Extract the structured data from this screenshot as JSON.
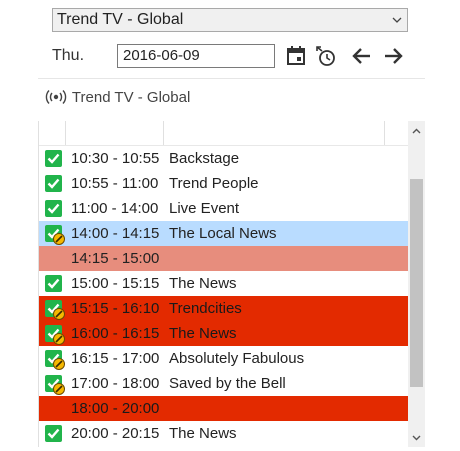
{
  "channel_select": {
    "value": "Trend TV - Global"
  },
  "date_bar": {
    "day": "Thu.",
    "date": "2016-06-09"
  },
  "channel_header": {
    "label": "Trend TV - Global"
  },
  "icons": {
    "calendar": "calendar-icon",
    "clock": "clock-icon",
    "back": "arrow-left-icon",
    "forward": "arrow-right-icon",
    "broadcast": "broadcast-icon"
  },
  "colors": {
    "check": "#21b44b",
    "warning": "#f5b800",
    "selected_row": "#b9dcff",
    "gap_row": "#e78d7d",
    "conflict_row": "#e32a00"
  },
  "schedule": [
    {
      "time": "10:30 - 10:55",
      "title": "Backstage",
      "status": "check",
      "style": "normal"
    },
    {
      "time": "10:55 - 11:00",
      "title": "Trend People",
      "status": "check",
      "style": "normal"
    },
    {
      "time": "11:00 - 14:00",
      "title": "Live Event",
      "status": "check",
      "style": "normal"
    },
    {
      "time": "14:00 - 14:15",
      "title": "The Local News",
      "status": "check-warning",
      "style": "blue"
    },
    {
      "time": "14:15 - 15:00",
      "title": "",
      "status": "none",
      "style": "salmon"
    },
    {
      "time": "15:00 - 15:15",
      "title": "The News",
      "status": "check",
      "style": "normal"
    },
    {
      "time": "15:15 - 16:10",
      "title": "Trendcities",
      "status": "check-warning",
      "style": "red"
    },
    {
      "time": "16:00 - 16:15",
      "title": "The News",
      "status": "check-warning",
      "style": "red"
    },
    {
      "time": "16:15 - 17:00",
      "title": "Absolutely Fabulous",
      "status": "check-warning",
      "style": "normal"
    },
    {
      "time": "17:00 - 18:00",
      "title": "Saved by the Bell",
      "status": "check-warning",
      "style": "normal"
    },
    {
      "time": "18:00 - 20:00",
      "title": "",
      "status": "none",
      "style": "red"
    },
    {
      "time": "20:00 - 20:15",
      "title": "The News",
      "status": "check",
      "style": "normal"
    }
  ]
}
